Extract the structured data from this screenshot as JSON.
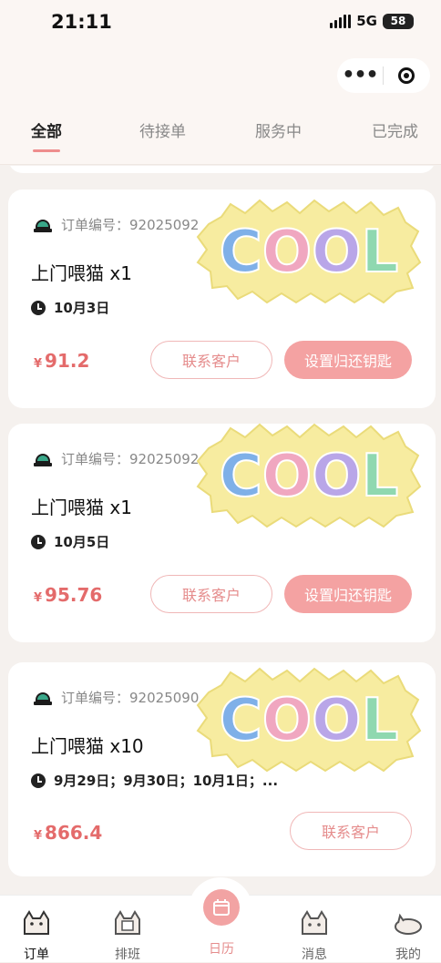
{
  "status": {
    "time": "21:11",
    "network": "5G",
    "battery": "58"
  },
  "tabs": [
    "全部",
    "待接单",
    "服务中",
    "已完成"
  ],
  "order_label": "订单编号：",
  "orders": [
    {
      "order_id": "92025092",
      "service": "上门喂猫 x1",
      "dates": "10月3日",
      "currency": "¥",
      "price": "91.2",
      "contact_label": "联系客户",
      "key_label": "设置归还钥匙"
    },
    {
      "order_id": "92025092",
      "service": "上门喂猫 x1",
      "dates": "10月5日",
      "currency": "¥",
      "price": "95.76",
      "contact_label": "联系客户",
      "key_label": "设置归还钥匙"
    },
    {
      "order_id": "92025090",
      "service": "上门喂猫 x10",
      "dates": "9月29日；9月30日；10月1日；...",
      "currency": "¥",
      "price": "866.4",
      "contact_label": "联系客户"
    }
  ],
  "sticker_text": "COOL",
  "tabbar": [
    "订单",
    "排班",
    "日历",
    "消息",
    "我的"
  ],
  "colors": {
    "accent": "#f4a2a2",
    "price": "#e46b6b",
    "sticker": "#f7eca0",
    "letters": [
      "#7fb0e8",
      "#f0a7c0",
      "#b9a6e8",
      "#8fd8b0"
    ]
  },
  "icons": [
    "service-bell-icon",
    "clock-icon",
    "more-icon",
    "target-icon",
    "cat-icon",
    "calendar-icon"
  ]
}
